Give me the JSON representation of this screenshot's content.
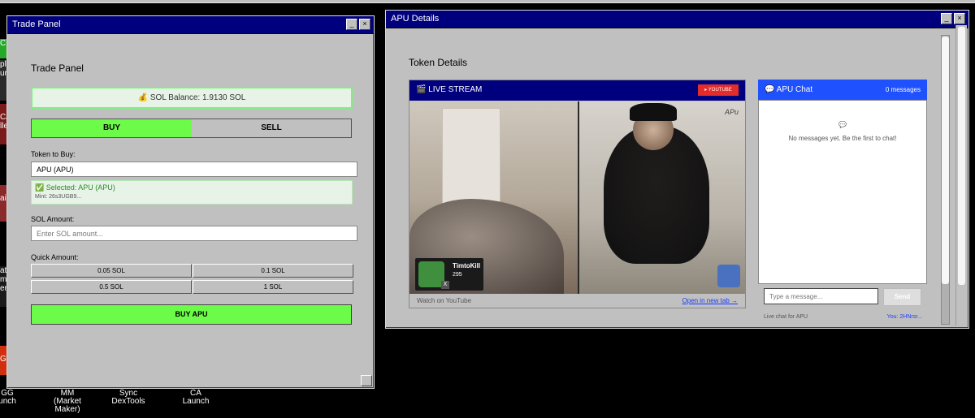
{
  "trade_panel": {
    "window_title": "Trade Panel",
    "heading": "Trade Panel",
    "balance_text": "💰 SOL Balance: 1.9130 SOL",
    "buy_label": "BUY",
    "sell_label": "SELL",
    "token_label": "Token to Buy:",
    "token_value": "APU (APU)",
    "selected_text": "✅ Selected: APU (APU)",
    "mint_text": "Mint: 26s3UGB9...",
    "sol_amount_label": "SOL Amount:",
    "sol_amount_placeholder": "Enter SOL amount...",
    "quick_amount_label": "Quick Amount:",
    "quick_amounts": [
      "0.05 SOL",
      "0.1 SOL",
      "0.5 SOL",
      "1 SOL"
    ],
    "buy_button_label": "BUY APU"
  },
  "apu_details": {
    "window_title": "APU Details",
    "heading": "Token Details",
    "stream": {
      "title": "🎬 LIVE STREAM",
      "youtube_button": "▸ YOUTUBE",
      "overlay_name": "TimtoKill",
      "overlay_count": "295",
      "overlay_x": "X",
      "overlay_brand": "APu",
      "watch_text": "Watch on YouTube",
      "open_tab_link": "Open in new tab →"
    },
    "chat": {
      "title": "💬 APU Chat",
      "count": "0 messages",
      "empty_icon": "💬",
      "empty_text": "No messages yet. Be the first to chat!",
      "input_placeholder": "Type a message...",
      "send_label": "Send",
      "footer_left": "Live chat for APU",
      "footer_right": "You: 2HNrsr..."
    }
  },
  "left_strip": {
    "fragments": [
      "C",
      "pla",
      "ur",
      "CA",
      "lle",
      "air",
      "ati",
      "mm",
      "ent",
      "GO"
    ]
  },
  "bottom_launchers": [
    {
      "label": "GG\nunch"
    },
    {
      "label": "MM\n(Market\nMaker)"
    },
    {
      "label": "Sync\nDexTools"
    },
    {
      "label": "CA\nLaunch"
    }
  ],
  "colors": {
    "title_bar": "#00007e",
    "buy_green": "#6dfb4a",
    "chat_header": "#1f51ff",
    "youtube_red": "#e32c2c"
  }
}
